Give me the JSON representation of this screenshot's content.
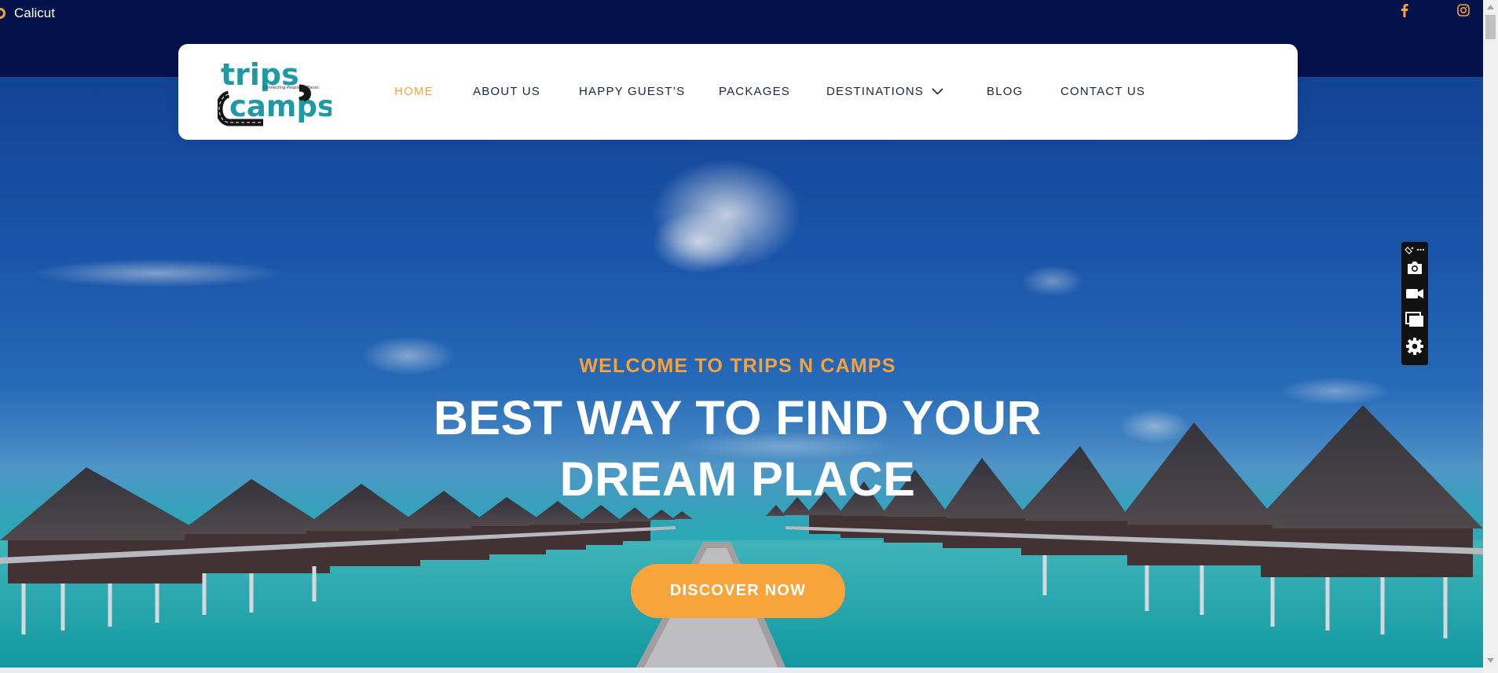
{
  "topbar": {
    "location_icon": "map-pin-icon",
    "location_text": "Calicut",
    "social": [
      {
        "name": "facebook-icon",
        "color": "#f7a23b"
      },
      {
        "name": "instagram-icon",
        "color": "#f7a23b"
      }
    ]
  },
  "navbar": {
    "logo_text_top": "trips",
    "logo_text_bottom": "camps",
    "logo_tagline": "Connecting People to Places",
    "items": [
      {
        "label": "HOME",
        "active": true
      },
      {
        "label": "ABOUT US",
        "active": false
      },
      {
        "label": "HAPPY GUEST’S",
        "active": false
      },
      {
        "label": "PACKAGES",
        "active": false
      },
      {
        "label": "DESTINATIONS",
        "active": false,
        "dropdown_icon": "chevron-down-icon"
      },
      {
        "label": "BLOG",
        "active": false
      },
      {
        "label": "CONTACT US",
        "active": false
      }
    ]
  },
  "hero": {
    "welcome": "WELCOME TO TRIPS N CAMPS",
    "headline_line1": "BEST WAY TO FIND YOUR",
    "headline_line2": "DREAM PLACE",
    "cta_label": "DISCOVER NOW"
  },
  "toolbar": {
    "icons": [
      "paint-bucket-icon",
      "more-icon",
      "camera-icon",
      "video-camera-icon",
      "windows-icon",
      "gear-icon"
    ]
  },
  "colors": {
    "topbar_bg": "#03124a",
    "accent": "#f7a23b",
    "nav_text": "#1b2440",
    "cta_bg": "#f9a43a",
    "white": "#ffffff"
  }
}
